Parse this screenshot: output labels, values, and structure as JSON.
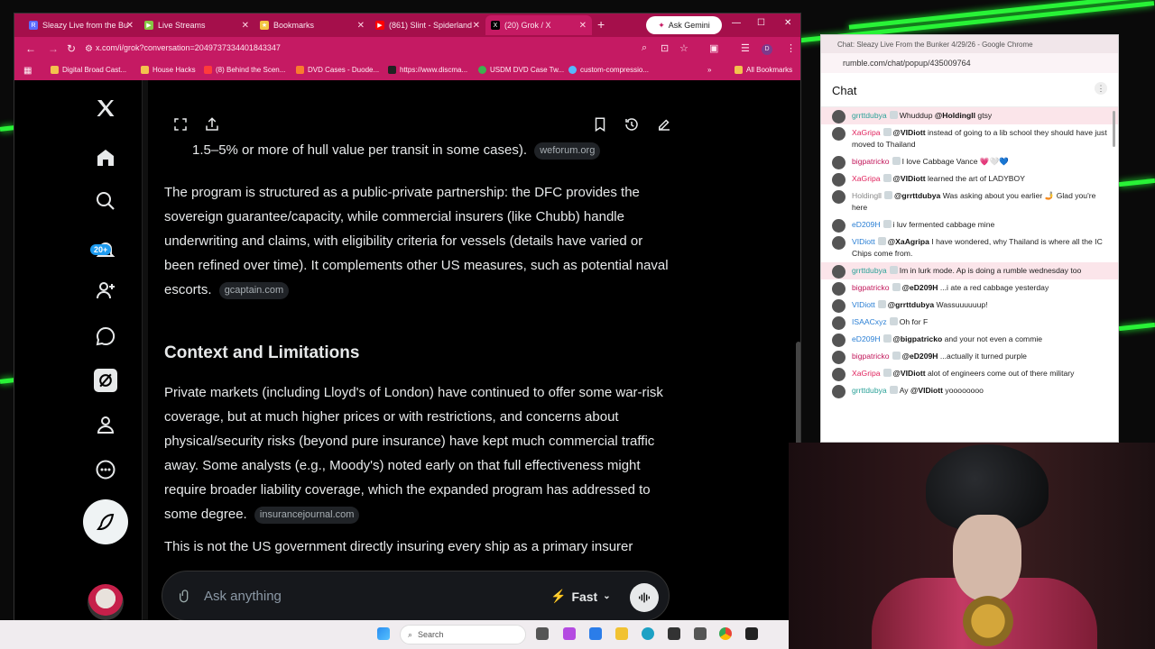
{
  "browser": {
    "tabs": [
      {
        "label": "Sleazy Live from the Bu",
        "favicon_color": "#5b6cff",
        "favicon_text": "R"
      },
      {
        "label": "Live Streams",
        "favicon_color": "#85c742",
        "favicon_text": "▶"
      },
      {
        "label": "Bookmarks",
        "favicon_color": "#f4c542",
        "favicon_text": "★"
      },
      {
        "label": "(861) Slint - Spiderland",
        "favicon_color": "#ff0000",
        "favicon_text": "▶"
      },
      {
        "label": "(20) Grok / X",
        "favicon_color": "#000000",
        "favicon_text": "X"
      }
    ],
    "gemini_label": "Ask Gemini",
    "url": "x.com/i/grok?conversation=2049737334401843347",
    "bookmarks": [
      "Digital Broad Cast...",
      "House Hacks",
      "(8) Behind the Scen...",
      "DVD Cases - Duode...",
      "https://www.discma...",
      "USDM DVD Case Tw...",
      "custom-compressio..."
    ],
    "all_bookmarks": "All Bookmarks"
  },
  "x": {
    "notification_badge": "20+",
    "truncated_line": "1.5–5% or more of hull value per transit in some cases).",
    "truncated_chip": "weforum.org",
    "para1": "The program is structured as a public-private partnership: the DFC provides the sovereign guarantee/capacity, while commercial insurers (like Chubb) handle underwriting and claims, with eligibility criteria for vessels (details have varied or been refined over time). It complements other US measures, such as potential naval escorts.",
    "para1_chip": "gcaptain.com",
    "heading": "Context and Limitations",
    "para2": "Private markets (including Lloyd's of London) have continued to offer some war-risk coverage, but at much higher prices or with restrictions, and concerns about physical/security risks (beyond pure insurance) have kept much commercial traffic away. Some analysts (e.g., Moody's) noted early on that full effectiveness might require broader liability coverage, which the expanded program has addressed to some degree.",
    "para2_chip": "insurancejournal.com",
    "para3": "This is not the US government directly insuring every ship as a primary insurer",
    "ask_placeholder": "Ask anything",
    "mode": "Fast"
  },
  "chat": {
    "window_title": "Chat: Sleazy Live From the Bunker 4/29/26 - Google Chrome",
    "url": "rumble.com/chat/popup/435009764",
    "title": "Chat",
    "messages": [
      {
        "user": "grrttdubya",
        "color": "#2aa198",
        "text": "Whuddup ",
        "mention": "@Holdingll",
        "after": " gtsy",
        "hl": true
      },
      {
        "user": "XaGripa",
        "color": "#e0245e",
        "text": "",
        "mention": "@VIDiott",
        "after": " instead of going to a lib school they should have just moved to Thailand",
        "hl": false
      },
      {
        "user": "bigpatricko",
        "color": "#c2185b",
        "text": "I love Cabbage Vance 💗🤍💙",
        "mention": "",
        "after": "",
        "hl": false
      },
      {
        "user": "XaGripa",
        "color": "#e0245e",
        "text": "",
        "mention": "@VIDiott",
        "after": " learned the art of LADYBOY",
        "hl": false
      },
      {
        "user": "Holdingll",
        "color": "#888888",
        "text": "",
        "mention": "@grrttdubya",
        "after": " Was asking about you earlier 🤳 Glad you're here",
        "hl": false
      },
      {
        "user": "eD209H",
        "color": "#2a7fd4",
        "text": "i luv fermented cabbage mine",
        "mention": "",
        "after": "",
        "hl": false
      },
      {
        "user": "VIDiott",
        "color": "#2a7fd4",
        "text": "",
        "mention": "@XaAgripa",
        "after": " I have wondered, why Thailand is where all the IC Chips come from.",
        "hl": false
      },
      {
        "user": "grrttdubya",
        "color": "#2aa198",
        "text": "Im in lurk mode. Ap is doing a rumble wednesday too",
        "mention": "",
        "after": "",
        "hl": true
      },
      {
        "user": "bigpatricko",
        "color": "#c2185b",
        "text": "",
        "mention": "@eD209H",
        "after": " ...i ate a red cabbage yesterday",
        "hl": false
      },
      {
        "user": "VIDiott",
        "color": "#2a7fd4",
        "text": "",
        "mention": "@grrttdubya",
        "after": " Wassuuuuuup!",
        "hl": false
      },
      {
        "user": "ISAACxyz",
        "color": "#2a7fd4",
        "text": "Oh for F",
        "mention": "",
        "after": "",
        "hl": false
      },
      {
        "user": "eD209H",
        "color": "#2a7fd4",
        "text": "",
        "mention": "@bigpatricko",
        "after": " and your not even a commie",
        "hl": false
      },
      {
        "user": "bigpatricko",
        "color": "#c2185b",
        "text": "",
        "mention": "@eD209H",
        "after": " ...actually it turned purple",
        "hl": false
      },
      {
        "user": "XaGripa",
        "color": "#e0245e",
        "text": "",
        "mention": "@VIDiott",
        "after": " alot of engineers come out of there military",
        "hl": false
      },
      {
        "user": "grrttdubya",
        "color": "#2aa198",
        "text": "Ay ",
        "mention": "@VIDiott",
        "after": " yoooooooo",
        "hl": false
      }
    ]
  },
  "taskbar": {
    "search_label": "Search"
  }
}
